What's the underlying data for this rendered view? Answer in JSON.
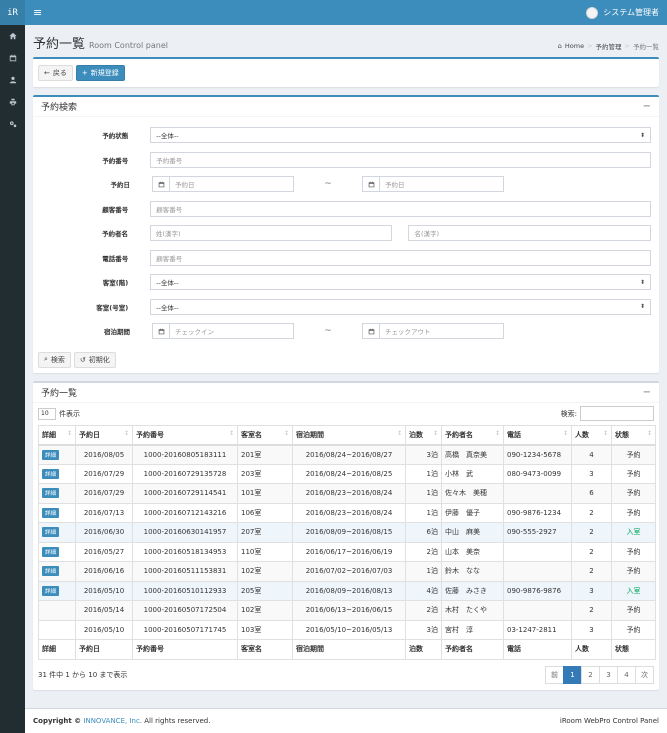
{
  "sidebar": {
    "logo": "iR",
    "items": [
      {
        "icon": "home-icon"
      },
      {
        "icon": "calendar-icon"
      },
      {
        "icon": "user-icon"
      },
      {
        "icon": "print-icon"
      },
      {
        "icon": "gears-icon"
      }
    ]
  },
  "topbar": {
    "user_name": "システム管理者"
  },
  "header": {
    "title": "予約一覧",
    "subtitle": "Room Control panel",
    "breadcrumb": [
      "Home",
      "予約管理",
      "予約一覧"
    ]
  },
  "toolbar": {
    "back_label": "戻る",
    "new_label": "新規登録"
  },
  "search": {
    "title": "予約検索",
    "status_label": "予約状態",
    "status_value": "--全体--",
    "number_label": "予約番号",
    "number_placeholder": "予約番号",
    "date_label": "予約日",
    "date_from_placeholder": "予約日",
    "date_to_placeholder": "予約日",
    "customer_label": "顧客番号",
    "customer_placeholder": "顧客番号",
    "name_label": "予約者名",
    "last_placeholder": "姓(漢字)",
    "first_placeholder": "名(漢字)",
    "phone_label": "電話番号",
    "phone_placeholder": "顧客番号",
    "floor_label": "客室(階)",
    "floor_value": "--全体--",
    "room_label": "客室(号室)",
    "room_value": "--全体--",
    "stay_label": "宿泊期間",
    "checkin_placeholder": "チェックイン",
    "checkout_placeholder": "チェックアウト",
    "tilde": "~",
    "search_button": "検索",
    "reset_button": "初期化"
  },
  "list": {
    "title": "予約一覧",
    "length_value": "10",
    "length_label": "件表示",
    "search_label": "検索:",
    "columns": [
      "詳細",
      "予約日",
      "予約番号",
      "客室名",
      "宿泊期間",
      "泊数",
      "予約者名",
      "電話",
      "人数",
      "状態"
    ],
    "detail_label": "詳細",
    "rows": [
      {
        "date": "2016/08/05",
        "no": "1000-20160805183111",
        "room": "201室",
        "period": "2016/08/24~2016/08/27",
        "nights": "3泊",
        "name": "高橋　真奈美",
        "phone": "090-1234-5678",
        "people": "4",
        "status": "予約",
        "detail": true,
        "hl": false,
        "green": false
      },
      {
        "date": "2016/07/29",
        "no": "1000-20160729135728",
        "room": "203室",
        "period": "2016/08/24~2016/08/25",
        "nights": "1泊",
        "name": "小林　武",
        "phone": "080-9473-0099",
        "people": "3",
        "status": "予約",
        "detail": true,
        "hl": false,
        "green": false
      },
      {
        "date": "2016/07/29",
        "no": "1000-20160729114541",
        "room": "101室",
        "period": "2016/08/23~2016/08/24",
        "nights": "1泊",
        "name": "佐々木　美穂",
        "phone": "",
        "people": "6",
        "status": "予約",
        "detail": true,
        "hl": false,
        "green": false
      },
      {
        "date": "2016/07/13",
        "no": "1000-20160712143216",
        "room": "106室",
        "period": "2016/08/23~2016/08/24",
        "nights": "1泊",
        "name": "伊藤　優子",
        "phone": "090-9876-1234",
        "people": "2",
        "status": "予約",
        "detail": true,
        "hl": false,
        "green": false
      },
      {
        "date": "2016/06/30",
        "no": "1000-20160630141957",
        "room": "207室",
        "period": "2016/08/09~2016/08/15",
        "nights": "6泊",
        "name": "中山　麻美",
        "phone": "090-555-2927",
        "people": "2",
        "status": "入室",
        "detail": true,
        "hl": true,
        "green": true
      },
      {
        "date": "2016/05/27",
        "no": "1000-20160518134953",
        "room": "110室",
        "period": "2016/06/17~2016/06/19",
        "nights": "2泊",
        "name": "山本　美奈",
        "phone": "",
        "people": "2",
        "status": "予約",
        "detail": true,
        "hl": false,
        "green": false
      },
      {
        "date": "2016/06/16",
        "no": "1000-20160511153831",
        "room": "102室",
        "period": "2016/07/02~2016/07/03",
        "nights": "1泊",
        "name": "鈴木　なな",
        "phone": "",
        "people": "2",
        "status": "予約",
        "detail": true,
        "hl": false,
        "green": false
      },
      {
        "date": "2016/05/10",
        "no": "1000-20160510112933",
        "room": "205室",
        "period": "2016/08/09~2016/08/13",
        "nights": "4泊",
        "name": "佐藤　みさき",
        "phone": "090-9876-9876",
        "people": "3",
        "status": "入室",
        "detail": true,
        "hl": true,
        "green": true
      },
      {
        "date": "2016/05/14",
        "no": "1000-20160507172504",
        "room": "102室",
        "period": "2016/06/13~2016/06/15",
        "nights": "2泊",
        "name": "木村　たくや",
        "phone": "",
        "people": "2",
        "status": "予約",
        "detail": false,
        "hl": false,
        "green": false
      },
      {
        "date": "2016/05/10",
        "no": "1000-20160507171745",
        "room": "103室",
        "period": "2016/05/10~2016/05/13",
        "nights": "3泊",
        "name": "宮村　淳",
        "phone": "03-1247-2811",
        "people": "3",
        "status": "予約",
        "detail": false,
        "hl": false,
        "green": false
      }
    ],
    "info": "31 件中 1 から 10 まで表示",
    "pager": {
      "prev": "前",
      "pages": [
        "1",
        "2",
        "3",
        "4"
      ],
      "next": "次",
      "active": "1"
    }
  },
  "footer": {
    "copyright": "Copyright ©",
    "company": "INNOVANCE, Inc.",
    "rights": "All rights reserved.",
    "product": "iRoom WebPro Control Panel"
  },
  "colors": {
    "primary": "#3c8dbc",
    "sidebar": "#222d32",
    "status_green": "#00a65a"
  }
}
